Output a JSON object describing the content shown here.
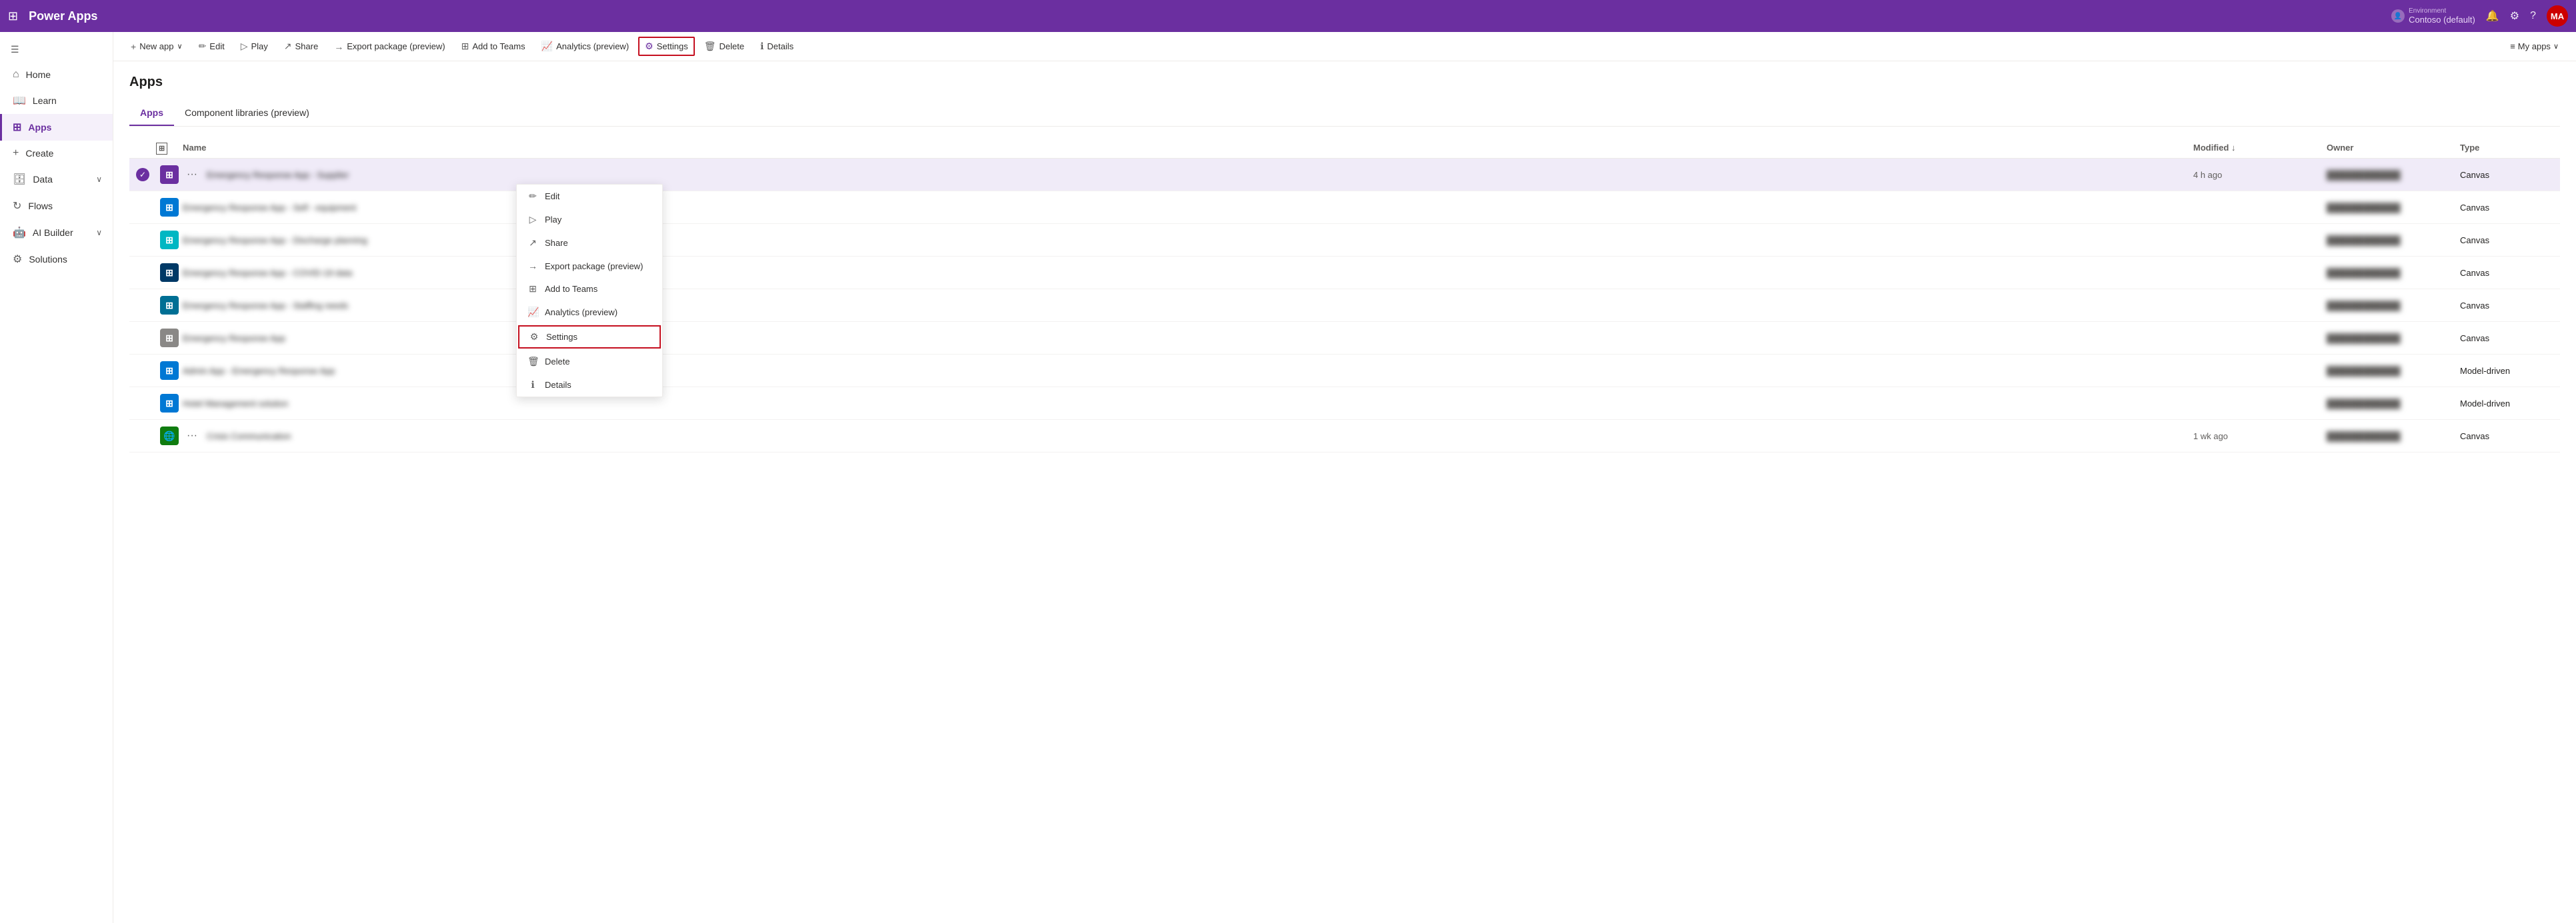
{
  "app": {
    "title": "Power Apps",
    "waffle": "⊞"
  },
  "topnav": {
    "environment_label": "Environment",
    "environment_name": "Contoso (default)",
    "avatar_initials": "MA"
  },
  "toolbar": {
    "new_app": "New app",
    "edit": "Edit",
    "play": "Play",
    "share": "Share",
    "export_package": "Export package (preview)",
    "add_to_teams": "Add to Teams",
    "analytics": "Analytics (preview)",
    "settings": "Settings",
    "delete": "Delete",
    "details": "Details",
    "my_apps": "My apps"
  },
  "sidebar": {
    "collapse_icon": "☰",
    "items": [
      {
        "label": "Home",
        "icon": "⌂",
        "active": false
      },
      {
        "label": "Learn",
        "icon": "📖",
        "active": false
      },
      {
        "label": "Apps",
        "icon": "⊞",
        "active": true
      },
      {
        "label": "Create",
        "icon": "+",
        "active": false
      },
      {
        "label": "Data",
        "icon": "🗄",
        "active": false,
        "chevron": "∨"
      },
      {
        "label": "Flows",
        "icon": "↻",
        "active": false
      },
      {
        "label": "AI Builder",
        "icon": "🤖",
        "active": false,
        "chevron": "∨"
      },
      {
        "label": "Solutions",
        "icon": "⚙",
        "active": false
      }
    ]
  },
  "page": {
    "title": "Apps",
    "tabs": [
      {
        "label": "Apps",
        "active": true
      },
      {
        "label": "Component libraries (preview)",
        "active": false
      }
    ]
  },
  "table": {
    "columns": [
      "",
      "",
      "Name",
      "Modified ↓",
      "Owner",
      "Type"
    ],
    "rows": [
      {
        "icon_class": "purple",
        "icon_text": "⊞",
        "name": "Emergency Response App - Supplier",
        "modified": "4 h ago",
        "owner": "blurred owner 1",
        "type": "Canvas",
        "selected": true,
        "has_dots": true
      },
      {
        "icon_class": "blue",
        "icon_text": "⊞",
        "name": "Emergency Response App - Self - equipment",
        "modified": "",
        "owner": "blurred owner 2",
        "type": "Canvas",
        "selected": false,
        "has_dots": false
      },
      {
        "icon_class": "teal",
        "icon_text": "⊞",
        "name": "Emergency Response App - Discharge planning",
        "modified": "",
        "owner": "blurred owner 3",
        "type": "Canvas",
        "selected": false,
        "has_dots": false
      },
      {
        "icon_class": "dark-blue",
        "icon_text": "⊞",
        "name": "Emergency Response App - COVID-19 data",
        "modified": "",
        "owner": "blurred owner 4",
        "type": "Canvas",
        "selected": false,
        "has_dots": false
      },
      {
        "icon_class": "dark-teal",
        "icon_text": "⊞",
        "name": "Emergency Response App - Staffing needs",
        "modified": "",
        "owner": "blurred owner 5",
        "type": "Canvas",
        "selected": false,
        "has_dots": false
      },
      {
        "icon_class": "gray",
        "icon_text": "⊞",
        "name": "Emergency Response App",
        "modified": "",
        "owner": "blurred owner 6",
        "type": "Canvas",
        "selected": false,
        "has_dots": false
      },
      {
        "icon_class": "blue",
        "icon_text": "⊞",
        "name": "Admin App - Emergency Response App",
        "modified": "",
        "owner": "blurred owner 7",
        "type": "Model-driven",
        "selected": false,
        "has_dots": false
      },
      {
        "icon_class": "blue",
        "icon_text": "⊞",
        "name": "Hotel Management solution",
        "modified": "",
        "owner": "blurred owner 8",
        "type": "Model-driven",
        "selected": false,
        "has_dots": false
      },
      {
        "icon_class": "globe",
        "icon_text": "🌐",
        "name": "Crisis Communication",
        "modified": "1 wk ago",
        "owner": "blurred owner 9",
        "type": "Canvas",
        "selected": false,
        "has_dots": true
      }
    ]
  },
  "context_menu": {
    "items": [
      {
        "icon": "✏",
        "label": "Edit"
      },
      {
        "icon": "▷",
        "label": "Play"
      },
      {
        "icon": "↗",
        "label": "Share"
      },
      {
        "icon": "→",
        "label": "Export package (preview)"
      },
      {
        "icon": "⊞",
        "label": "Add to Teams"
      },
      {
        "icon": "📈",
        "label": "Analytics (preview)"
      },
      {
        "icon": "⚙",
        "label": "Settings",
        "highlighted": true
      },
      {
        "icon": "🗑",
        "label": "Delete"
      },
      {
        "icon": "ℹ",
        "label": "Details"
      }
    ]
  }
}
